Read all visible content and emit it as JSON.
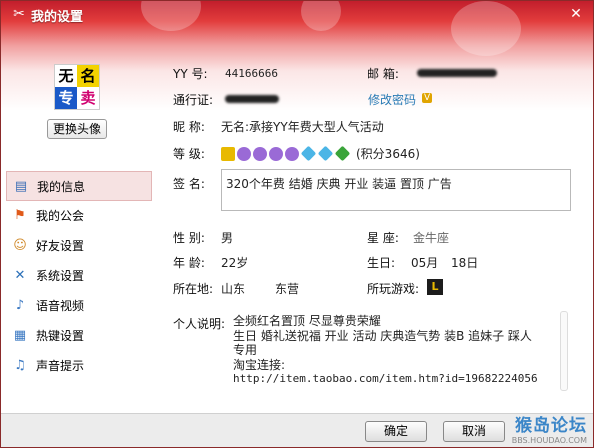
{
  "window": {
    "title": "我的设置",
    "close_label": "✕"
  },
  "avatar": {
    "chars": [
      "无",
      "名",
      "专",
      "卖"
    ],
    "change_label": "更换头像"
  },
  "sidebar": {
    "items": [
      {
        "label": "我的信息",
        "icon": "card-icon",
        "glyph": "▤"
      },
      {
        "label": "我的公会",
        "icon": "flag-icon",
        "glyph": "⚑"
      },
      {
        "label": "好友设置",
        "icon": "user-icon",
        "glyph": "☺"
      },
      {
        "label": "系统设置",
        "icon": "wrench-icon",
        "glyph": "✕"
      },
      {
        "label": "语音视频",
        "icon": "microphone-icon",
        "glyph": "♪"
      },
      {
        "label": "热键设置",
        "icon": "keyboard-icon",
        "glyph": "▦"
      },
      {
        "label": "声音提示",
        "icon": "speaker-icon",
        "glyph": "♫"
      }
    ]
  },
  "profile": {
    "yy_label": "YY 号:",
    "yy_value": "44166666",
    "email_label": "邮  箱:",
    "passport_label": "通行证:",
    "change_password": "修改密码",
    "vip_badge": "V",
    "nickname_label": "昵  称:",
    "nickname_value": "无名:承接YY年费大型人气活动",
    "level_label": "等  级:",
    "level_points": "(积分3646)",
    "sign_label": "签  名:",
    "sign_value": "320个年费 结婚 庆典 开业 装逼 置顶 广告",
    "gender_label": "性  别:",
    "gender_value": "男",
    "star_label": "星  座:",
    "star_value": "金牛座",
    "age_label": "年  龄:",
    "age_value": "22岁",
    "birthday_label": "生日:",
    "birthday_month": "05月",
    "birthday_day": "18日",
    "location_label": "所在地:",
    "location_province": "山东",
    "location_city": "东营",
    "games_label": "所玩游戏:",
    "game_glyph": "L",
    "desc_label": "个人说明:",
    "desc_line1": "全频红名置顶   尽显尊贵荣耀",
    "desc_line2": "生日 婚礼送祝福 开业 活动 庆典造气势 装B 追妹子 踩人",
    "desc_line3": "专用",
    "desc_line4": "淘宝连接:",
    "desc_line5": "http://item.taobao.com/item.htm?id=19682224056"
  },
  "footer": {
    "ok_label": "确定",
    "cancel_label": "取消"
  },
  "watermark": {
    "main": "猴岛论坛",
    "sub": "BBS.HOUDAO.COM"
  }
}
